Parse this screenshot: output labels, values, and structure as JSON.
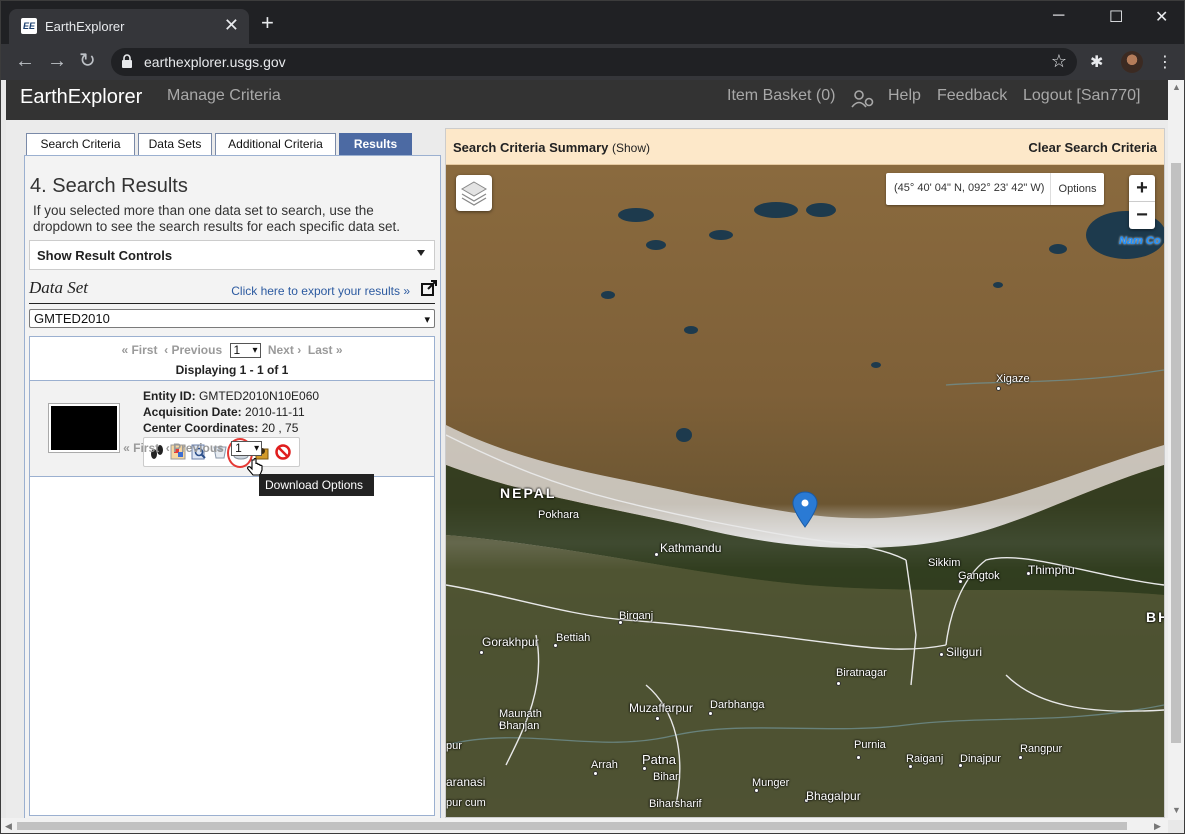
{
  "browser": {
    "tab_title": "EarthExplorer",
    "url": "earthexplorer.usgs.gov",
    "new_tab": "+",
    "close_tab": "✕"
  },
  "header": {
    "brand": "EarthExplorer",
    "manage": "Manage Criteria",
    "basket": "Item Basket (0)",
    "help": "Help",
    "feedback": "Feedback",
    "logout": "Logout [San770]"
  },
  "tabs": [
    "Search Criteria",
    "Data Sets",
    "Additional Criteria",
    "Results"
  ],
  "results_panel": {
    "title": "4. Search Results",
    "description": "If you selected more than one data set to search, use the dropdown to see the search results for each specific data set.",
    "result_controls": "Show Result Controls",
    "dataset_label": "Data Set",
    "export_link": "Click here to export your results »",
    "dataset_value": "GMTED2010",
    "pager": {
      "first": "« First",
      "previous": "‹ Previous",
      "page": "1",
      "next": "Next ›",
      "last": "Last »"
    },
    "displaying": "Displaying 1 - 1 of 1",
    "entity_label": "Entity ID:",
    "entity_value": "GMTED2010N10E060",
    "acq_label": "Acquisition Date:",
    "acq_value": "2010-11-11",
    "center_label": "Center Coordinates:",
    "center_value": "20 , 75",
    "tooltip": "Download Options"
  },
  "map": {
    "summary_title": "Search Criteria Summary",
    "summary_show": "(Show)",
    "clear": "Clear Search Criteria",
    "coords": "(45° 40' 04\" N, 092° 23' 42\" W)",
    "options": "Options",
    "zoom_in": "+",
    "zoom_out": "−",
    "labels": {
      "nepal": "NEPAL",
      "pokhara": "Pokhara",
      "kathmandu": "Kathmandu",
      "xigaze": "Xigaze",
      "sikkim": "Sikkim",
      "gangtok": "Gangtok",
      "thimphu": "Thimphu",
      "bh": "BH",
      "birganj": "Birganj",
      "gorakhpur": "Gorakhpur",
      "bettiah": "Bettiah",
      "siliguri": "Siliguri",
      "biratnagar": "Biratnagar",
      "muzaffarpur": "Muzaffarpur",
      "darbhanga": "Darbhanga",
      "maunath": "Maunath",
      "bhanjan": "Bhanjan",
      "purnia": "Purnia",
      "raiganj": "Raiganj",
      "dinajpur": "Dinajpur",
      "rangpur": "Rangpur",
      "patna": "Patna",
      "arrah": "Arrah",
      "bihar": "Bihar",
      "munger": "Munger",
      "bhagalpur": "Bhagalpur",
      "biharsharif": "Biharsharif",
      "aranasi": "aranasi",
      "pur": "pur",
      "purcum": "pur cum",
      "namco": "Nam Co"
    }
  }
}
